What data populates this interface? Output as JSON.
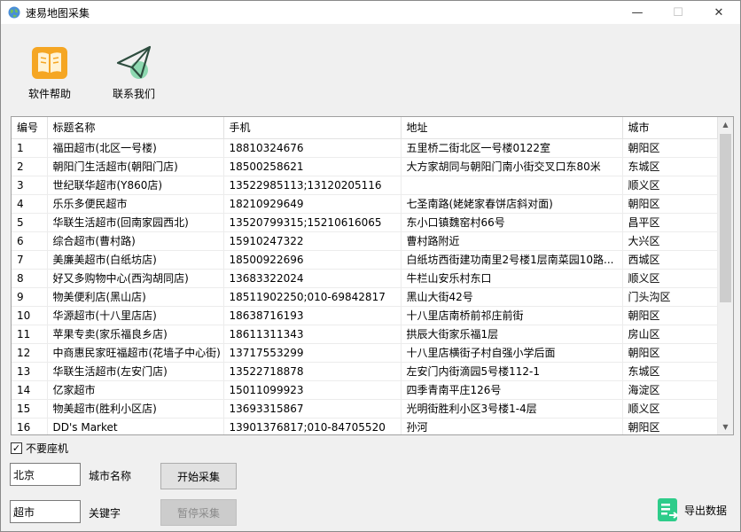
{
  "window": {
    "title": "速易地图采集",
    "minimize_glyph": "—",
    "maximize_glyph": "☐",
    "close_glyph": "✕"
  },
  "toolbar": {
    "help_label": "软件帮助",
    "help_icon": "book-icon",
    "contact_label": "联系我们",
    "contact_icon": "paper-plane-icon"
  },
  "table": {
    "columns": [
      "编号",
      "标题名称",
      "手机",
      "地址",
      "城市"
    ],
    "rows": [
      [
        "1",
        "福田超市(北区一号楼)",
        "18810324676",
        "五里桥二街北区一号楼0122室",
        "朝阳区"
      ],
      [
        "2",
        "朝阳门生活超市(朝阳门店)",
        "18500258621",
        "大方家胡同与朝阳门南小街交叉口东80米",
        "东城区"
      ],
      [
        "3",
        "世纪联华超市(Y860店)",
        "13522985113;13120205116",
        "",
        "顺义区"
      ],
      [
        "4",
        "乐乐多便民超市",
        "18210929649",
        "七圣南路(姥姥家春饼店斜对面)",
        "朝阳区"
      ],
      [
        "5",
        "华联生活超市(回南家园西北)",
        "13520799315;15210616065",
        "东小口镇魏窑村66号",
        "昌平区"
      ],
      [
        "6",
        "综合超市(曹村路)",
        "15910247322",
        "曹村路附近",
        "大兴区"
      ],
      [
        "7",
        "美廉美超市(白纸坊店)",
        "18500922696",
        "白纸坊西街建功南里2号楼1层南菜园10路...",
        "西城区"
      ],
      [
        "8",
        "好又多购物中心(西沟胡同店)",
        "13683322024",
        "牛栏山安乐村东口",
        "顺义区"
      ],
      [
        "9",
        "物美便利店(黑山店)",
        "18511902250;010-69842817",
        "黑山大街42号",
        "门头沟区"
      ],
      [
        "10",
        "华源超市(十八里店店)",
        "18638716193",
        "十八里店南桥前祁庄前街",
        "朝阳区"
      ],
      [
        "11",
        "苹果专卖(家乐福良乡店)",
        "18611311343",
        "拱辰大街家乐福1层",
        "房山区"
      ],
      [
        "12",
        "中商惠民家旺福超市(花墙子中心街)",
        "13717553299",
        "十八里店横街子村自强小学后面",
        "朝阳区"
      ],
      [
        "13",
        "华联生活超市(左安门店)",
        "13522718878",
        "左安门内街滴园5号楼112-1",
        "东城区"
      ],
      [
        "14",
        "亿家超市",
        "15011099923",
        "四季青南平庄126号",
        "海淀区"
      ],
      [
        "15",
        "物美超市(胜利小区店)",
        "13693315867",
        "光明街胜利小区3号楼1-4层",
        "顺义区"
      ],
      [
        "16",
        "DD's Market",
        "13901376817;010-84705520",
        "孙河",
        "朝阳区"
      ]
    ]
  },
  "options": {
    "no_landline_label": "不要座机",
    "no_landline_checked": true,
    "check_glyph": "✓"
  },
  "form": {
    "city_value": "北京",
    "city_label": "城市名称",
    "keyword_value": "超市",
    "keyword_label": "关键字"
  },
  "buttons": {
    "start_label": "开始采集",
    "pause_label": "暂停采集"
  },
  "export": {
    "label": "导出数据",
    "icon": "export-sheet-icon"
  },
  "colors": {
    "book_icon": "#f5a623",
    "plane_icon": "#2e7d5b",
    "plane_accent": "#3cc47c",
    "export_icon": "#2ecc8a"
  }
}
